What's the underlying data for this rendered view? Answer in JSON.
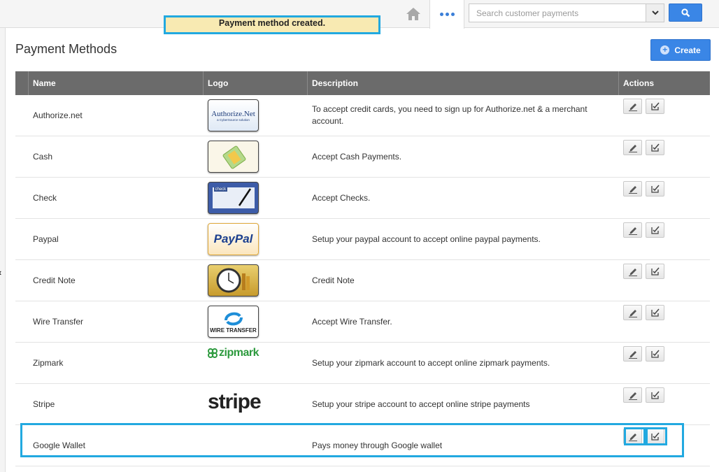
{
  "topbar": {
    "search_placeholder": "Search customer payments",
    "search_value": ""
  },
  "toast": {
    "message": "Payment method created."
  },
  "page": {
    "title": "Payment Methods",
    "create_label": "Create"
  },
  "table": {
    "headers": {
      "name": "Name",
      "logo": "Logo",
      "description": "Description",
      "actions": "Actions"
    },
    "rows": [
      {
        "name": "Authorize.net",
        "description": "To accept credit cards, you need to sign up for Authorize.net & a merchant account.",
        "logo_text": "Authorize.Net",
        "logo_sub": "a CyberSource solution"
      },
      {
        "name": "Cash",
        "description": "Accept Cash Payments."
      },
      {
        "name": "Check",
        "description": "Accept Checks.",
        "logo_text": "check"
      },
      {
        "name": "Paypal",
        "description": "Setup your paypal account to accept online paypal payments.",
        "logo_text": "PayPal"
      },
      {
        "name": "Credit Note",
        "description": "Credit Note"
      },
      {
        "name": "Wire Transfer",
        "description": "Accept Wire Transfer.",
        "logo_text": "WIRE TRANSFER"
      },
      {
        "name": "Zipmark",
        "description": "Setup your zipmark account to accept online zipmark payments.",
        "logo_text": "zipmark"
      },
      {
        "name": "Stripe",
        "description": "Setup your stripe account to accept online stripe payments",
        "logo_text": "stripe"
      },
      {
        "name": "Google Wallet",
        "description": "Pays money through Google wallet"
      }
    ]
  },
  "colors": {
    "accent": "#3a86e6",
    "highlight": "#22a9e0",
    "header_bg": "#6b6b6b",
    "toast_bg": "#f8eab2"
  }
}
